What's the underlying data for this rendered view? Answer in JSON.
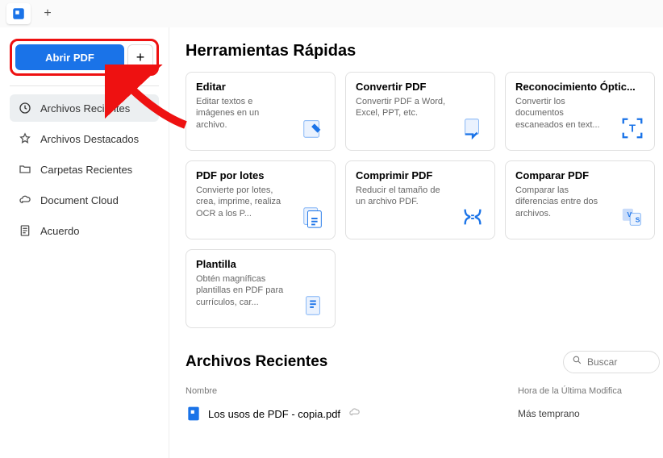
{
  "tabs": {
    "plus": "+"
  },
  "sidebar": {
    "open_label": "Abrir PDF",
    "plus": "+",
    "items": [
      {
        "label": "Archivos Recientes"
      },
      {
        "label": "Archivos Destacados"
      },
      {
        "label": "Carpetas Recientes"
      },
      {
        "label": "Document Cloud"
      },
      {
        "label": "Acuerdo"
      }
    ]
  },
  "main": {
    "tools_title": "Herramientas Rápidas",
    "cards": [
      {
        "title": "Editar",
        "desc": "Editar textos e imágenes en un archivo."
      },
      {
        "title": "Convertir PDF",
        "desc": "Convertir PDF a Word, Excel, PPT, etc."
      },
      {
        "title": "Reconocimiento Óptic...",
        "desc": "Convertir los documentos escaneados en text..."
      },
      {
        "title": "PDF por lotes",
        "desc": "Convierte por lotes, crea, imprime, realiza OCR a los P..."
      },
      {
        "title": "Comprimir PDF",
        "desc": "Reducir el tamaño de un archivo PDF."
      },
      {
        "title": "Comparar PDF",
        "desc": "Comparar las diferencias entre dos archivos."
      },
      {
        "title": "Plantilla",
        "desc": "Obtén magníficas plantillas en PDF para currículos, car..."
      }
    ],
    "recent_title": "Archivos Recientes",
    "search_placeholder": "Buscar",
    "col_name": "Nombre",
    "col_date": "Hora de la Última Modifica",
    "files": [
      {
        "name": "Los usos de PDF - copia.pdf",
        "date": "Más temprano"
      }
    ]
  }
}
